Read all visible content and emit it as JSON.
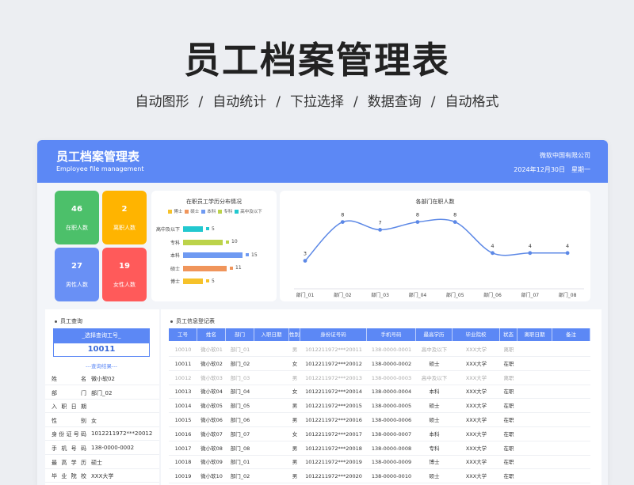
{
  "hero": {
    "title": "员工档案管理表",
    "subtitle": [
      "自动图形",
      "/",
      "自动统计",
      "/",
      "下拉选择",
      "/",
      "数据查询",
      "/",
      "自动格式"
    ]
  },
  "header": {
    "title": "员工档案管理表",
    "english": "Employee file management",
    "company": "微软中国有限公司",
    "date": "2024年12月30日",
    "weekday": "星期一"
  },
  "stats": [
    {
      "value": "46",
      "label": "在职人数",
      "color": "#4cc06a"
    },
    {
      "value": "2",
      "label": "离职人数",
      "color": "#ffb400"
    },
    {
      "value": "27",
      "label": "男性人数",
      "color": "#6990f5"
    },
    {
      "value": "19",
      "label": "女性人数",
      "color": "#ff5a5a"
    }
  ],
  "edu_chart": {
    "title": "在职员工学历分布情况",
    "legend": [
      {
        "name": "博士",
        "color": "#f6c22a"
      },
      {
        "name": "硕士",
        "color": "#f0955b"
      },
      {
        "name": "本科",
        "color": "#6f9af2"
      },
      {
        "name": "专科",
        "color": "#bcd34a"
      },
      {
        "name": "高中及以下",
        "color": "#22c8cf"
      }
    ]
  },
  "dept_chart": {
    "title": "各部门在职人数",
    "line_color": "#5c88e6"
  },
  "chart_data": [
    {
      "type": "bar",
      "orientation": "horizontal",
      "title": "在职员工学历分布情况",
      "categories": [
        "高中及以下",
        "专科",
        "本科",
        "硕士",
        "博士"
      ],
      "values": [
        5,
        10,
        15,
        11,
        5
      ],
      "colors": [
        "#22c8cf",
        "#bcd34a",
        "#6f9af2",
        "#f0955b",
        "#f6c22a"
      ],
      "xlim": [
        0,
        16
      ],
      "legend": "top"
    },
    {
      "type": "line",
      "title": "各部门在职人数",
      "categories": [
        "部门_01",
        "部门_02",
        "部门_03",
        "部门_04",
        "部门_05",
        "部门_06",
        "部门_07",
        "部门_08"
      ],
      "values": [
        3,
        8,
        7,
        8,
        8,
        4,
        4,
        4
      ],
      "ylim": [
        0,
        10
      ],
      "grid": false
    }
  ],
  "query": {
    "heading": "员工查询",
    "select_placeholder": "_选择查询工号_",
    "selected_id": "10011",
    "result_label": "---查询结果---",
    "fields": [
      {
        "key": "姓名",
        "value": "微小软02"
      },
      {
        "key": "部门",
        "value": "部门_02"
      },
      {
        "key": "入职日期",
        "value": ""
      },
      {
        "key": "性别",
        "value": "女"
      },
      {
        "key": "身份证号码",
        "value": "1012211972***20012"
      },
      {
        "key": "手机号码",
        "value": "138-0000-0002"
      },
      {
        "key": "最高学历",
        "value": "硕士"
      },
      {
        "key": "毕业院校",
        "value": "XXX大学"
      }
    ]
  },
  "register": {
    "heading": "员工信息登记表",
    "columns": [
      "工号",
      "姓名",
      "部门",
      "入职日期",
      "性别",
      "身份证号码",
      "手机号码",
      "最高学历",
      "毕业院校",
      "状态",
      "离职日期",
      "备注"
    ],
    "rows": [
      {
        "dim": true,
        "cells": [
          "10010",
          "微小软01",
          "部门_01",
          "",
          "男",
          "1012211972***20011",
          "138-0000-0001",
          "高中及以下",
          "XXX大学",
          "离职",
          "",
          ""
        ]
      },
      {
        "dim": false,
        "cells": [
          "10011",
          "微小软02",
          "部门_02",
          "",
          "女",
          "1012211972***20012",
          "138-0000-0002",
          "硕士",
          "XXX大学",
          "在职",
          "",
          ""
        ]
      },
      {
        "dim": true,
        "cells": [
          "10012",
          "微小软03",
          "部门_03",
          "",
          "男",
          "1012211972***20013",
          "138-0000-0003",
          "高中及以下",
          "XXX大学",
          "离职",
          "",
          ""
        ]
      },
      {
        "dim": false,
        "cells": [
          "10013",
          "微小软04",
          "部门_04",
          "",
          "女",
          "1012211972***20014",
          "138-0000-0004",
          "本科",
          "XXX大学",
          "在职",
          "",
          ""
        ]
      },
      {
        "dim": false,
        "cells": [
          "10014",
          "微小软05",
          "部门_05",
          "",
          "男",
          "1012211972***20015",
          "138-0000-0005",
          "硕士",
          "XXX大学",
          "在职",
          "",
          ""
        ]
      },
      {
        "dim": false,
        "cells": [
          "10015",
          "微小软06",
          "部门_06",
          "",
          "男",
          "1012211972***20016",
          "138-0000-0006",
          "硕士",
          "XXX大学",
          "在职",
          "",
          ""
        ]
      },
      {
        "dim": false,
        "cells": [
          "10016",
          "微小软07",
          "部门_07",
          "",
          "女",
          "1012211972***20017",
          "138-0000-0007",
          "本科",
          "XXX大学",
          "在职",
          "",
          ""
        ]
      },
      {
        "dim": false,
        "cells": [
          "10017",
          "微小软08",
          "部门_08",
          "",
          "男",
          "1012211972***20018",
          "138-0000-0008",
          "专科",
          "XXX大学",
          "在职",
          "",
          ""
        ]
      },
      {
        "dim": false,
        "cells": [
          "10018",
          "微小软09",
          "部门_01",
          "",
          "男",
          "1012211972***20019",
          "138-0000-0009",
          "博士",
          "XXX大学",
          "在职",
          "",
          ""
        ]
      },
      {
        "dim": false,
        "cells": [
          "10019",
          "微小软10",
          "部门_02",
          "",
          "男",
          "1012211972***20020",
          "138-0000-0010",
          "硕士",
          "XXX大学",
          "在职",
          "",
          ""
        ]
      }
    ]
  }
}
